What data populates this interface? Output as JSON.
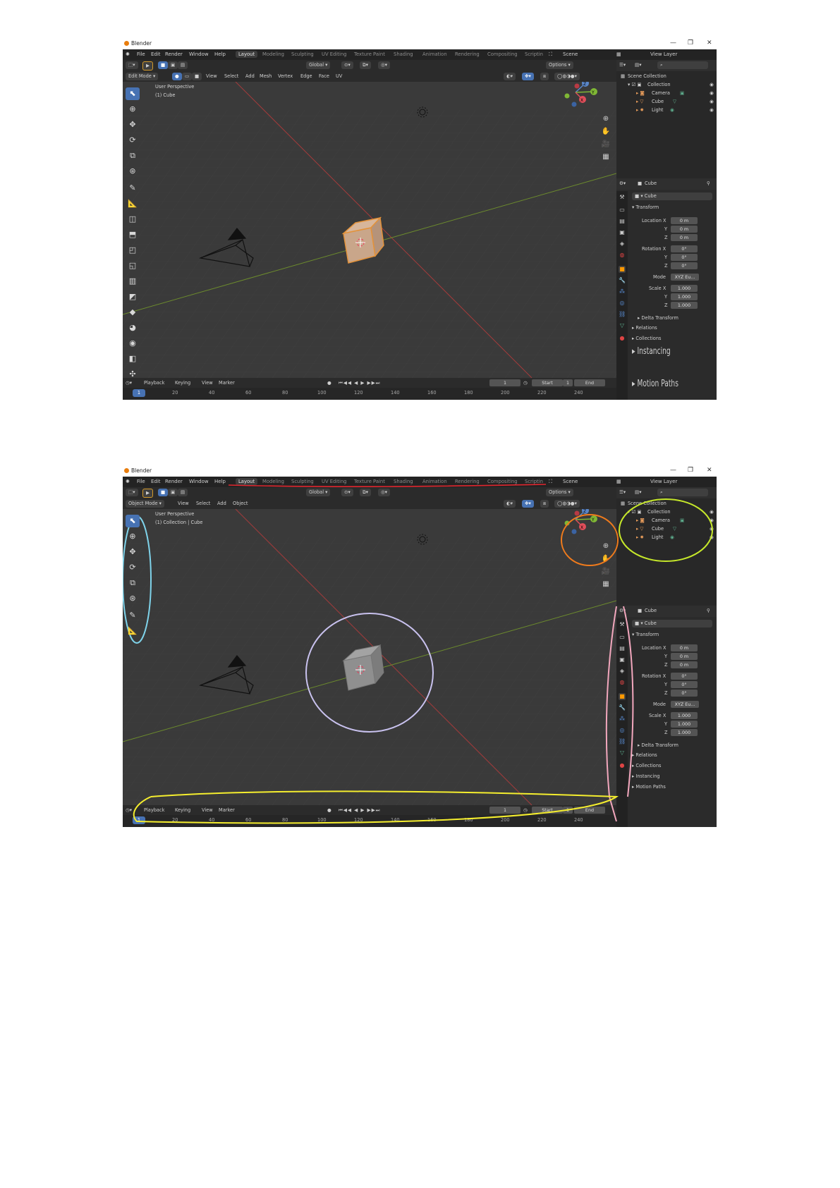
{
  "app": {
    "title": "Blender",
    "window_controls": [
      "—",
      "❐",
      "✕"
    ],
    "menu": [
      "File",
      "Edit",
      "Render",
      "Window",
      "Help"
    ],
    "workspaces": [
      "Layout",
      "Modeling",
      "Sculpting",
      "UV Editing",
      "Texture Paint",
      "Shading",
      "Animation",
      "Rendering",
      "Compositing",
      "Scriptin"
    ],
    "scene": "Scene",
    "view_layer": "View Layer"
  },
  "header": {
    "orientation": "Global",
    "options": "Options"
  },
  "shot1": {
    "mode": "Edit Mode",
    "menus": [
      "View",
      "Select",
      "Add",
      "Mesh",
      "Vertex",
      "Edge",
      "Face",
      "UV"
    ],
    "perspective": "User Perspective",
    "object": "(1) Cube",
    "cube_color": "#c9a68a"
  },
  "shot2": {
    "mode": "Object Mode",
    "menus": [
      "View",
      "Select",
      "Add",
      "Object"
    ],
    "perspective": "User Perspective",
    "object": "(1) Collection | Cube",
    "cube_color": "#8f8f8f",
    "annotation_colors": {
      "workspace_underline": "#e0262e",
      "toolbar": "#7fd3ea",
      "gizmo": "#f07b1c",
      "outliner": "#c6e82a",
      "cube": "#c9c2ef",
      "properties_tabs": "#f2a7bd",
      "timeline": "#f5ee2e"
    }
  },
  "outliner": {
    "title": "Scene Collection",
    "items": [
      {
        "label": "Collection",
        "icon": "collection-icon"
      },
      {
        "label": "Camera",
        "icon": "camera-icon"
      },
      {
        "label": "Cube",
        "icon": "mesh-icon"
      },
      {
        "label": "Light",
        "icon": "light-icon"
      }
    ]
  },
  "properties": {
    "object_name": "Cube",
    "mesh_name": "Cube",
    "transform": "Transform",
    "location_label": "Location X",
    "rotation_label": "Rotation X",
    "scale_label": "Scale X",
    "y": "Y",
    "z": "Z",
    "loc": [
      "0 m",
      "0 m",
      "0 m"
    ],
    "rot": [
      "0°",
      "0°",
      "0°"
    ],
    "scale": [
      "1.000",
      "1.000",
      "1.000"
    ],
    "mode_label": "Mode",
    "mode_value": "XYZ Eu...",
    "delta": "Delta Transform",
    "relations": "Relations",
    "collections": "Collections",
    "instancing": "Instancing",
    "motion_paths": "Motion Paths",
    "motion_paths_short": "Motion Paths"
  },
  "timeline": {
    "menus": [
      "Playback",
      "Keying",
      "View",
      "Marker"
    ],
    "current_frame": "1",
    "start_label": "Start",
    "start": "1",
    "end_label": "End",
    "ticks": [
      "20",
      "40",
      "60",
      "80",
      "100",
      "120",
      "140",
      "160",
      "180",
      "200",
      "220",
      "240"
    ],
    "frame_marker": "1"
  },
  "gizmo": {
    "z": "Z",
    "y": "Y",
    "x": "X"
  }
}
